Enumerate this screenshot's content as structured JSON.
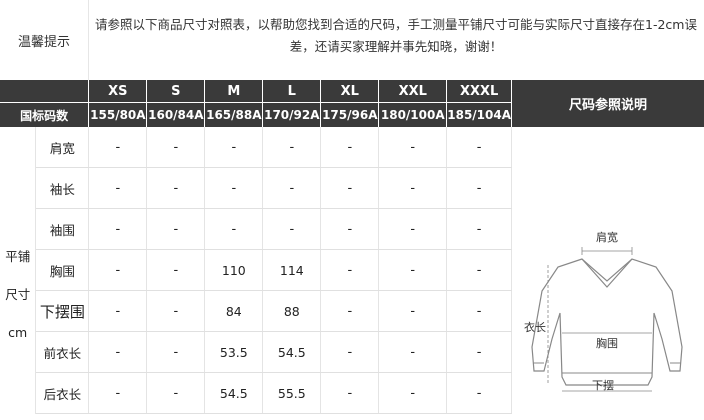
{
  "notice": {
    "label": "温馨提示",
    "text": "请参照以下商品尺寸对照表，以帮助您找到合适的尺码，手工测量平铺尺寸可能与实际尺寸直接存在1-2cm误差，还请买家理解并事先知晓，谢谢！"
  },
  "table": {
    "size_header_row": [
      "XS",
      "S",
      "M",
      "L",
      "XL",
      "XXL",
      "XXXL"
    ],
    "national_label": "国标码数",
    "national_codes": [
      "155/80A",
      "160/84A",
      "165/88A",
      "170/92A",
      "175/96A",
      "180/100A",
      "185/104A"
    ],
    "explain_header": "尺码参照说明",
    "group_label_lines": [
      "平铺",
      "尺寸",
      "cm"
    ],
    "rows": [
      {
        "name": "肩宽",
        "values": [
          "-",
          "-",
          "-",
          "-",
          "-",
          "-",
          "-"
        ]
      },
      {
        "name": "袖长",
        "values": [
          "-",
          "-",
          "-",
          "-",
          "-",
          "-",
          "-"
        ]
      },
      {
        "name": "袖围",
        "values": [
          "-",
          "-",
          "-",
          "-",
          "-",
          "-",
          "-"
        ]
      },
      {
        "name": "胸围",
        "values": [
          "-",
          "-",
          "110",
          "114",
          "-",
          "-",
          "-"
        ]
      },
      {
        "name": "下摆围",
        "values": [
          "-",
          "-",
          "84",
          "88",
          "-",
          "-",
          "-"
        ]
      },
      {
        "name": "前衣长",
        "values": [
          "-",
          "-",
          "53.5",
          "54.5",
          "-",
          "-",
          "-"
        ]
      },
      {
        "name": "后衣长",
        "values": [
          "-",
          "-",
          "54.5",
          "55.5",
          "-",
          "-",
          "-"
        ]
      }
    ]
  },
  "diagram": {
    "shoulder_label": "肩宽",
    "length_label": "衣长",
    "chest_label": "胸围",
    "hem_label": "下摆",
    "line_color": "#888888"
  }
}
